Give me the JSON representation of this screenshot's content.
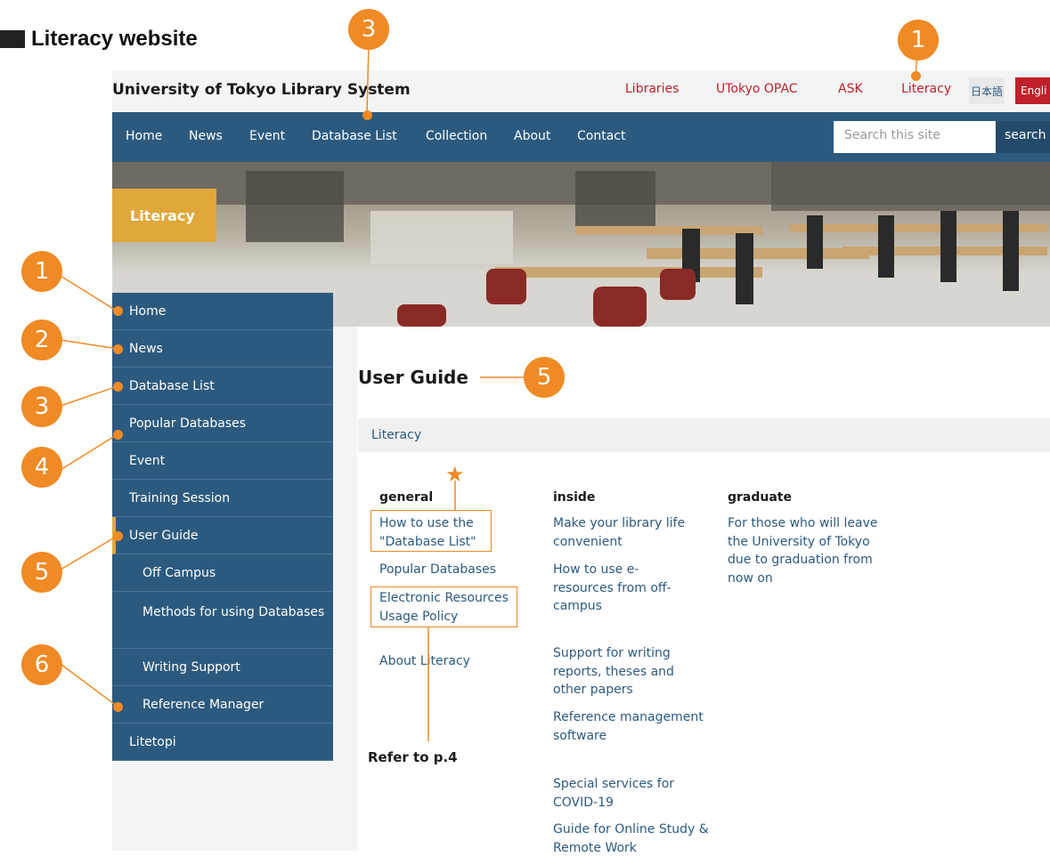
{
  "page": {
    "heading": "Literacy website"
  },
  "header": {
    "site_name": "University of Tokyo Library System",
    "links": [
      "Libraries",
      "UTokyo OPAC",
      "ASK",
      "Literacy"
    ],
    "lang_ja": "日本語",
    "lang_en": "Engli"
  },
  "nav": {
    "items": [
      "Home",
      "News",
      "Event",
      "Database List",
      "Collection",
      "About",
      "Contact"
    ],
    "search_placeholder": "Search this site",
    "search_button": "search"
  },
  "hero": {
    "label": "Literacy"
  },
  "sidebar": {
    "items": [
      "Home",
      "News",
      "Database List",
      "Popular Databases",
      "Event",
      "Training Session",
      "User Guide",
      "Off Campus",
      "Methods for using Databases",
      "Writing Support",
      "Reference Manager",
      "Litetopi"
    ]
  },
  "main": {
    "title": "User Guide",
    "breadcrumb": "Literacy",
    "columns": [
      {
        "heading": "general",
        "links": [
          "How to use the \"Database List\"",
          "Popular Databases",
          "Electronic Resources Usage Policy",
          "About Literacy"
        ]
      },
      {
        "heading": "inside",
        "links": [
          "Make your library life convenient",
          "How to use e-resources from off-campus",
          "Support for writing reports, theses and other papers",
          "Reference management software",
          "Special services for COVID-19",
          "Guide for Online Study & Remote Work"
        ]
      },
      {
        "heading": "graduate",
        "links": [
          "For those who will leave the University of Tokyo due to graduation from now on"
        ]
      }
    ]
  },
  "annotations": {
    "numbers": [
      "1",
      "3",
      "1",
      "2",
      "3",
      "4",
      "5",
      "6",
      "5"
    ],
    "star": "★",
    "note": "Refer to p.4"
  },
  "colors": {
    "nav_bg": "#2c5a7f",
    "accent_red": "#c0202a",
    "label_gold": "#e0a73a",
    "annotation_orange": "#f08a24",
    "link_blue": "#2d5a80"
  }
}
